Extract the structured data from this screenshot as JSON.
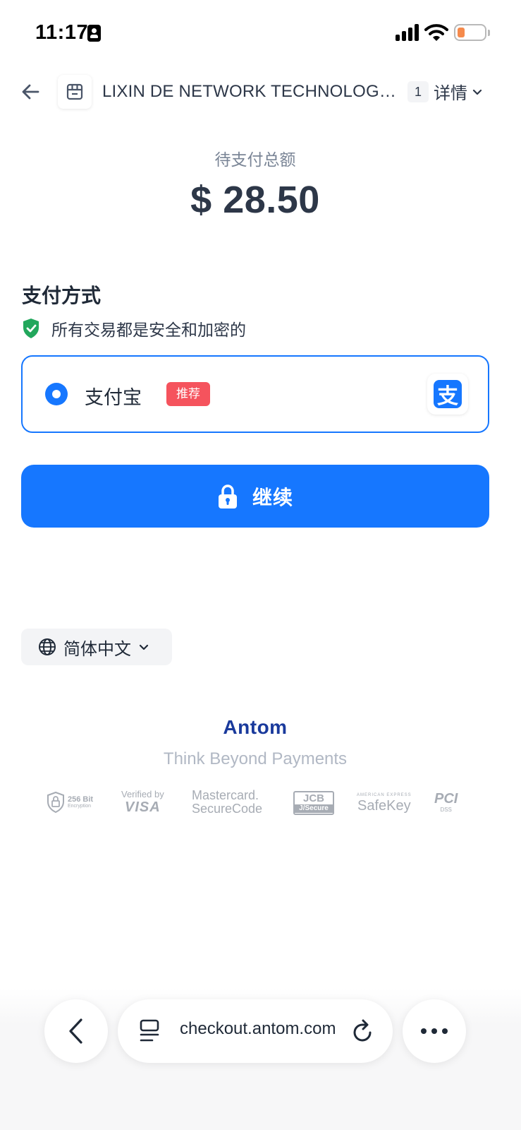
{
  "status_bar": {
    "time": "11:17"
  },
  "header": {
    "merchant_name": "LIXIN DE NETWORK TECHNOLOGY CO., LIMITED",
    "quantity": "1",
    "details_label": "详情"
  },
  "amount": {
    "label": "待支付总额",
    "value": "$ 28.50"
  },
  "payment": {
    "section_title": "支付方式",
    "secure_text": "所有交易都是安全和加密的",
    "option": {
      "name": "支付宝",
      "badge": "推荐",
      "selected": true,
      "logo_char": "支"
    },
    "continue_label": "继续"
  },
  "language": {
    "label": "简体中文"
  },
  "brand": {
    "logo": "Antom",
    "tagline": "Think Beyond Payments"
  },
  "badges": {
    "b256_line1": "256 Bit",
    "b256_line2": "Encryption",
    "visa_line1": "Verified by",
    "visa_line2": "VISA",
    "mc_line1": "Mastercard.",
    "mc_line2": "SecureCode",
    "jcb_line1": "JCB",
    "jcb_line2": "J/Secure",
    "safekey_line1": "AMERICAN EXPRESS",
    "safekey_line2": "SafeKey",
    "pci_line1": "PCI",
    "pci_line2": "DSS"
  },
  "browser": {
    "url": "checkout.antom.com"
  },
  "colors": {
    "accent": "#1677ff",
    "badge_red": "#f5535d",
    "shield_green": "#22a75c",
    "brand": "#1a3a9c"
  },
  "icons": [
    "id-card-icon",
    "signal-icon",
    "wifi-icon",
    "battery-icon",
    "back-arrow-icon",
    "store-icon",
    "chevron-down-icon",
    "shield-check-icon",
    "radio-icon",
    "alipay-icon",
    "lock-icon",
    "globe-icon",
    "chevron-left-icon",
    "tabs-icon",
    "reload-icon",
    "more-icon"
  ]
}
